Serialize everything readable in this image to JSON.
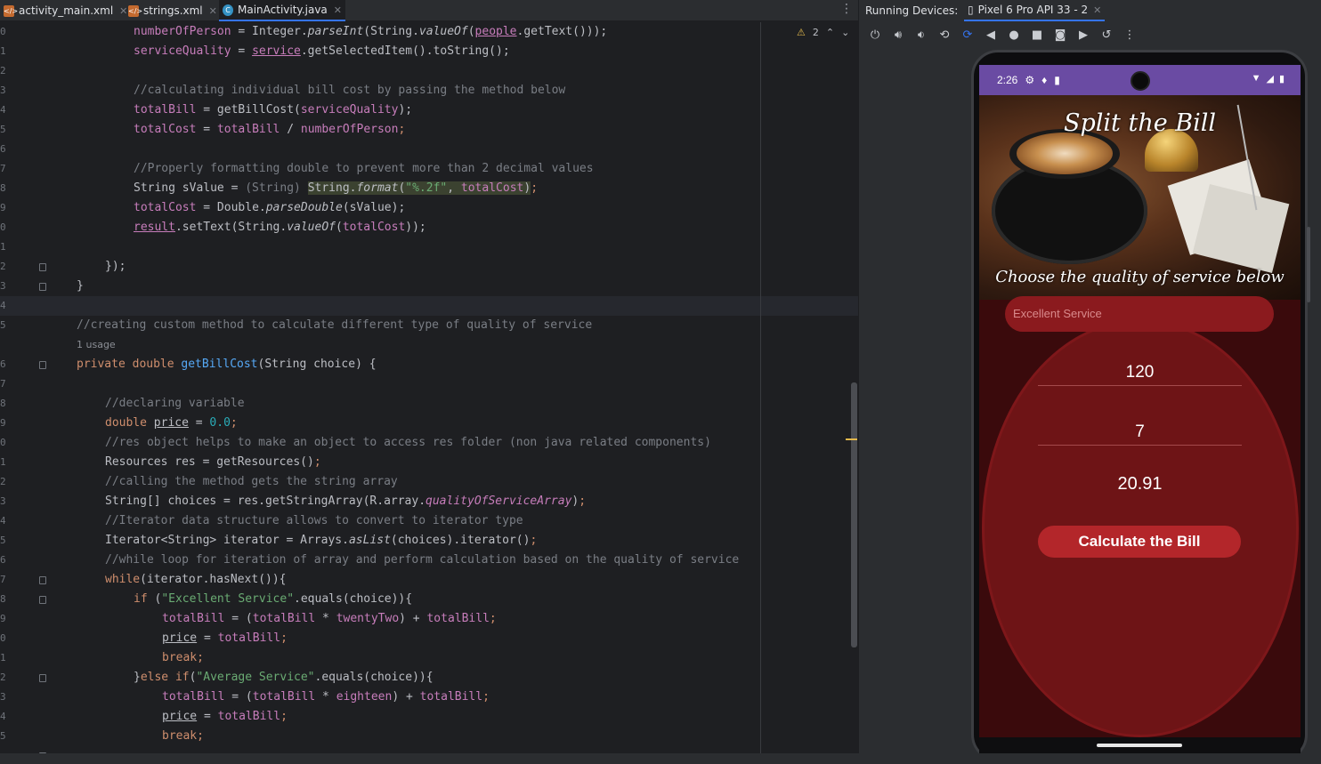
{
  "editor_tabs": [
    {
      "name": "activity_main.xml",
      "icon": "xml-file-icon",
      "color": "#c46a2f"
    },
    {
      "name": "strings.xml",
      "icon": "xml-file-icon",
      "color": "#c46a2f"
    },
    {
      "name": "MainActivity.java",
      "icon": "java-class-icon",
      "color": "#3592c4"
    }
  ],
  "inspection": {
    "warnings": "2"
  },
  "gutter_lines": [
    "0",
    "1",
    "2",
    "3",
    "4",
    "5",
    "6",
    "7",
    "8",
    "9",
    "0",
    "1",
    "2",
    "3",
    "4",
    "5",
    "6",
    "7",
    "8",
    "9",
    "0",
    "1",
    "2",
    "3",
    "4",
    "5",
    "6",
    "7",
    "8",
    "9",
    "0",
    "1",
    "2",
    "3",
    "4",
    "5"
  ],
  "code_lines": [
    {
      "indent": 150,
      "html": "numberOfPerson = Integer.parseInt(String.valueOf(people.getText()));",
      "parts": [
        [
          "f",
          "numberOfPerson"
        ],
        [
          "",
          " = Integer."
        ],
        [
          "it",
          "parseInt"
        ],
        [
          "",
          "(String."
        ],
        [
          "it",
          "valueOf"
        ],
        [
          "",
          "("
        ],
        [
          "fu",
          "people"
        ],
        [
          "",
          ".getText()));"
        ]
      ]
    },
    {
      "indent": 150,
      "parts": [
        [
          "f",
          "serviceQuality"
        ],
        [
          "",
          " = "
        ],
        [
          "fu",
          "service"
        ],
        [
          "",
          ".getSelectedItem().toString();"
        ]
      ]
    },
    {
      "indent": 150,
      "parts": []
    },
    {
      "indent": 150,
      "parts": [
        [
          "c",
          "//calculating individual bill cost by passing the method below"
        ]
      ]
    },
    {
      "indent": 150,
      "parts": [
        [
          "f",
          "totalBill"
        ],
        [
          "",
          " = getBillCost("
        ],
        [
          "f",
          "serviceQuality"
        ],
        [
          "",
          ");"
        ]
      ]
    },
    {
      "indent": 150,
      "parts": [
        [
          "f",
          "totalCost"
        ],
        [
          "",
          " = "
        ],
        [
          "f",
          "totalBill"
        ],
        [
          "",
          " / "
        ],
        [
          "f",
          "numberOfPerson"
        ],
        [
          "k",
          ";"
        ]
      ]
    },
    {
      "indent": 150,
      "parts": []
    },
    {
      "indent": 150,
      "parts": [
        [
          "c",
          "//Properly formatting double to prevent more than 2 decimal values"
        ]
      ]
    },
    {
      "indent": 150,
      "parts": [
        [
          "",
          "String sValue = "
        ],
        [
          "c",
          "(String)"
        ],
        [
          "",
          " "
        ],
        [
          "hl",
          "String."
        ],
        [
          "hlit",
          "format"
        ],
        [
          "hl",
          "("
        ],
        [
          "hls",
          "\"%.2f\""
        ],
        [
          "hl",
          ", "
        ],
        [
          "hlf",
          "totalCost"
        ],
        [
          "hl",
          ")"
        ],
        [
          "k",
          ";"
        ]
      ]
    },
    {
      "indent": 150,
      "parts": [
        [
          "f",
          "totalCost"
        ],
        [
          "",
          " = Double."
        ],
        [
          "it",
          "parseDouble"
        ],
        [
          "",
          "(sValue);"
        ]
      ]
    },
    {
      "indent": 150,
      "parts": [
        [
          "fu",
          "result"
        ],
        [
          "",
          ".setText(String."
        ],
        [
          "it",
          "valueOf"
        ],
        [
          "",
          "("
        ],
        [
          "f",
          "totalCost"
        ],
        [
          "",
          "));"
        ]
      ]
    },
    {
      "indent": 150,
      "parts": []
    },
    {
      "indent": 118,
      "parts": [
        [
          "",
          "});"
        ]
      ]
    },
    {
      "indent": 86,
      "parts": [
        [
          "",
          "}"
        ]
      ]
    },
    {
      "indent": 86,
      "parts": []
    },
    {
      "indent": 86,
      "parts": [
        [
          "c",
          "//creating custom method to calculate different type of quality of service"
        ]
      ]
    },
    {
      "indent": 86,
      "parts": [
        [
          "k",
          "private double "
        ],
        [
          "m",
          "getBillCost"
        ],
        [
          "",
          "(String choice) {"
        ]
      ]
    },
    {
      "indent": 86,
      "parts": []
    },
    {
      "indent": 118,
      "parts": [
        [
          "c",
          "//declaring variable"
        ]
      ]
    },
    {
      "indent": 118,
      "parts": [
        [
          "k",
          "double "
        ],
        [
          "u",
          "price"
        ],
        [
          "",
          " = "
        ],
        [
          "n",
          "0.0"
        ],
        [
          "k",
          ";"
        ]
      ]
    },
    {
      "indent": 118,
      "parts": [
        [
          "c",
          "//res object helps to make an object to access res folder (non java related components)"
        ]
      ]
    },
    {
      "indent": 118,
      "parts": [
        [
          "",
          "Resources res = getResources()"
        ],
        [
          "k",
          ";"
        ]
      ]
    },
    {
      "indent": 118,
      "parts": [
        [
          "c",
          "//calling the method gets the string array"
        ]
      ]
    },
    {
      "indent": 118,
      "parts": [
        [
          "",
          "String[] choices = res.getStringArray(R.array."
        ],
        [
          "fit",
          "qualityOfServiceArray"
        ],
        [
          "",
          ")"
        ],
        [
          "k",
          ";"
        ]
      ]
    },
    {
      "indent": 118,
      "parts": [
        [
          "c",
          "//Iterator data structure allows to convert to iterator type"
        ]
      ]
    },
    {
      "indent": 118,
      "parts": [
        [
          "",
          "Iterator<String> iterator = Arrays."
        ],
        [
          "it",
          "asList"
        ],
        [
          "",
          "(choices).iterator()"
        ],
        [
          "k",
          ";"
        ]
      ]
    },
    {
      "indent": 118,
      "parts": [
        [
          "c",
          "//while loop for iteration of array and perform calculation based on the quality of service"
        ]
      ]
    },
    {
      "indent": 118,
      "parts": [
        [
          "k",
          "while"
        ],
        [
          "",
          "(iterator.hasNext()){"
        ]
      ]
    },
    {
      "indent": 150,
      "parts": [
        [
          "k",
          "if "
        ],
        [
          "",
          "("
        ],
        [
          "s",
          "\"Excellent Service\""
        ],
        [
          "",
          ".equals(choice)){"
        ]
      ]
    },
    {
      "indent": 182,
      "parts": [
        [
          "f",
          "totalBill"
        ],
        [
          "",
          " = ("
        ],
        [
          "f",
          "totalBill"
        ],
        [
          "",
          " * "
        ],
        [
          "f",
          "twentyTwo"
        ],
        [
          "",
          ") + "
        ],
        [
          "f",
          "totalBill"
        ],
        [
          "k",
          ";"
        ]
      ]
    },
    {
      "indent": 182,
      "parts": [
        [
          "u",
          "price"
        ],
        [
          "",
          " = "
        ],
        [
          "f",
          "totalBill"
        ],
        [
          "k",
          ";"
        ]
      ]
    },
    {
      "indent": 182,
      "parts": [
        [
          "k",
          "break;"
        ]
      ]
    },
    {
      "indent": 150,
      "parts": [
        [
          "",
          "}"
        ],
        [
          "k",
          "else if"
        ],
        [
          "",
          "("
        ],
        [
          "s",
          "\"Average Service\""
        ],
        [
          "",
          ".equals(choice)){"
        ]
      ]
    },
    {
      "indent": 182,
      "parts": [
        [
          "f",
          "totalBill"
        ],
        [
          "",
          " = ("
        ],
        [
          "f",
          "totalBill"
        ],
        [
          "",
          " * "
        ],
        [
          "f",
          "eighteen"
        ],
        [
          "",
          ") + "
        ],
        [
          "f",
          "totalBill"
        ],
        [
          "k",
          ";"
        ]
      ]
    },
    {
      "indent": 182,
      "parts": [
        [
          "u",
          "price"
        ],
        [
          "",
          " = "
        ],
        [
          "f",
          "totalBill"
        ],
        [
          "k",
          ";"
        ]
      ]
    },
    {
      "indent": 182,
      "parts": [
        [
          "k",
          "break;"
        ]
      ]
    }
  ],
  "usage_hint": "1 usage",
  "running_devices": {
    "title": "Running Devices:",
    "device_tab": "Pixel 6 Pro API 33 - 2",
    "toolbar": [
      "power-icon",
      "volume-up-icon",
      "volume-down-icon",
      "rotate-left-icon",
      "rotate-right-icon",
      "back-icon",
      "home-icon",
      "overview-icon",
      "screenshot-icon",
      "screen-record-icon",
      "reset-icon",
      "more-icon"
    ]
  },
  "phone": {
    "time": "2:26",
    "app_title": "Split the Bill",
    "subtitle": "Choose the quality of service below",
    "service_selected": "Excellent Service",
    "amount": "120",
    "people": "7",
    "result": "20.91",
    "button": "Calculate the Bill",
    "accent": "#b3262a"
  }
}
